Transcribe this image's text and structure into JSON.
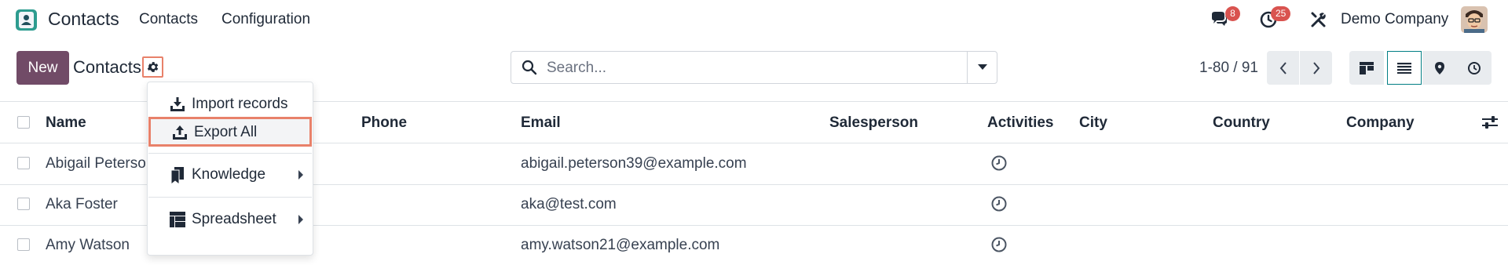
{
  "navbar": {
    "app_name": "Contacts",
    "menu": [
      "Contacts",
      "Configuration"
    ],
    "messages_count": "8",
    "activities_count": "25",
    "company": "Demo Company",
    "accent": "#714b67",
    "badge_color": "#d9534f"
  },
  "control_panel": {
    "new_label": "New",
    "title": "Contacts",
    "search_placeholder": "Search...",
    "pager": "1-80 / 91",
    "views": [
      "kanban-icon",
      "list-icon",
      "map-icon",
      "activity-icon"
    ],
    "active_view": "list"
  },
  "list": {
    "columns": [
      "Name",
      "Phone",
      "Email",
      "Salesperson",
      "Activities",
      "City",
      "Country",
      "Company"
    ],
    "rows": [
      {
        "name": "Abigail Peterson",
        "phone": "",
        "email": "abigail.peterson39@example.com",
        "salesperson": "",
        "city": "",
        "country": "",
        "company": ""
      },
      {
        "name": "Aka Foster",
        "phone": "",
        "email": "aka@test.com",
        "salesperson": "",
        "city": "",
        "country": "",
        "company": ""
      },
      {
        "name": "Amy Watson",
        "phone": "",
        "email": "amy.watson21@example.com",
        "salesperson": "",
        "city": "",
        "country": "",
        "company": ""
      }
    ]
  },
  "dropdown": {
    "items": [
      {
        "label": "Import records",
        "icon": "download-icon"
      },
      {
        "label": "Export All",
        "icon": "upload-icon",
        "highlighted": true
      },
      {
        "label": "Knowledge",
        "icon": "knowledge-icon",
        "submenu": true
      },
      {
        "label": "Spreadsheet",
        "icon": "spreadsheet-icon",
        "submenu": true
      }
    ]
  },
  "highlight_color": "#e8816a"
}
